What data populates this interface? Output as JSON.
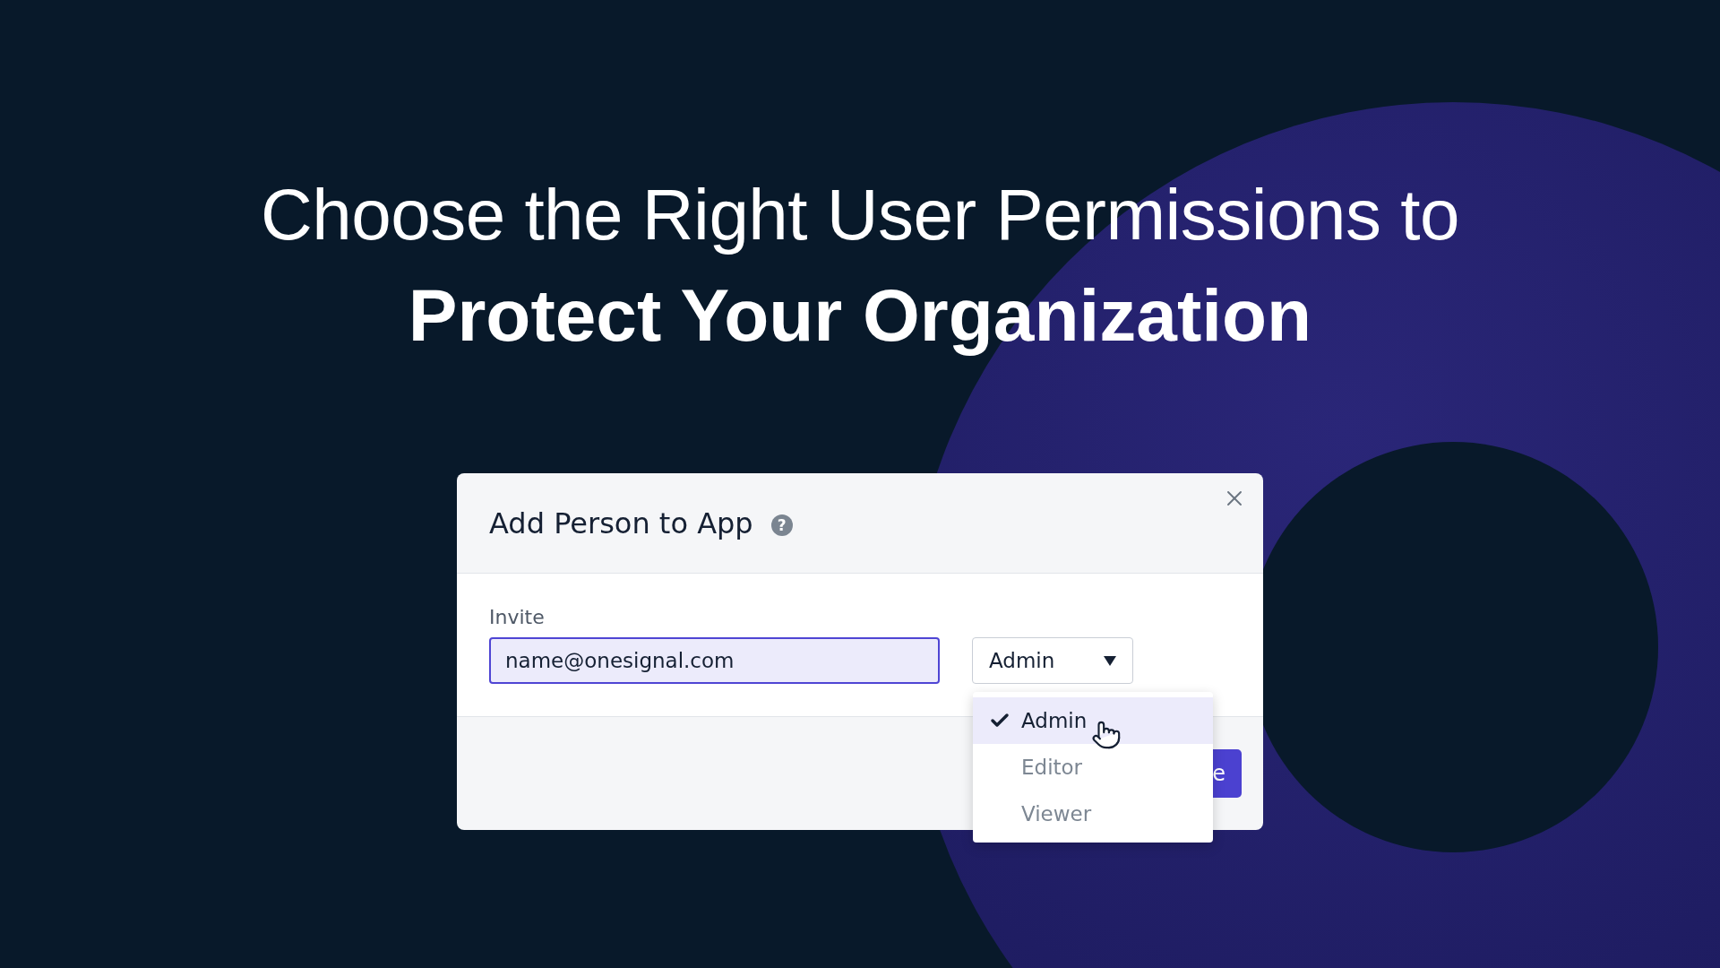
{
  "headline_lines": [
    {
      "text": "Choose the Right User Permissions to",
      "kind": "light"
    },
    {
      "text": "Protect Your Organization",
      "kind": "bold"
    }
  ],
  "dialog": {
    "title": "Add Person to App",
    "help": "?",
    "invite_label": "Invite",
    "email_value": "name@onesignal.com",
    "role_value": "Admin",
    "role_menu": [
      {
        "label": "Admin",
        "selected": true
      },
      {
        "label": "Editor",
        "selected": false
      },
      {
        "label": "Viewer",
        "selected": false
      }
    ],
    "footer_button": "e"
  }
}
